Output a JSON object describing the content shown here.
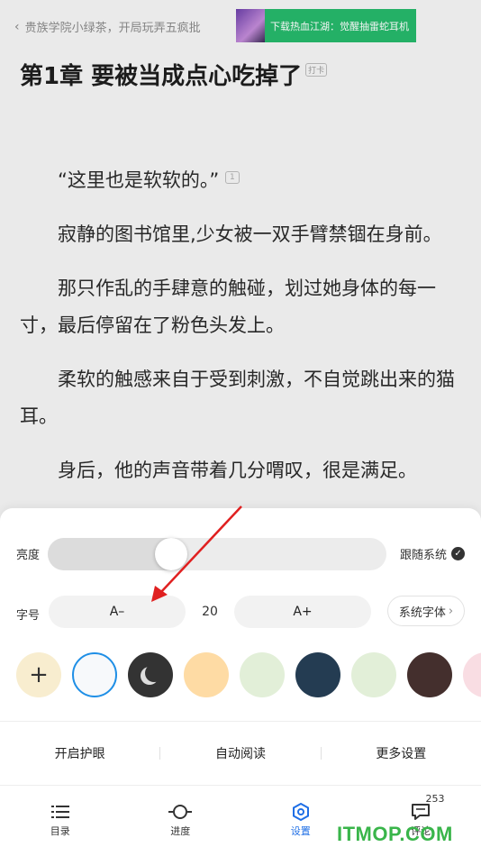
{
  "reader": {
    "back_title": "贵族学院小绿茶，开局玩弄五疯批",
    "ad_text": "下载热血江湖：觉醒抽雷蛇耳机",
    "chapter_title": "第1章 要被当成点心吃掉了",
    "checkin_label": "打卡",
    "comment_count": "1",
    "paragraphs": [
      "“这里也是软软的。”",
      "寂静的图书馆里,少女被一双手臂禁锢在身前。",
      "那只作乱的手肆意的触碰，划过她身体的每一寸，最后停留在了粉色头发上。",
      "柔软的触感来自于受到刺激，不自觉跳出来的猫耳。",
      "身后，他的声音带着几分喟叹，很是满足。"
    ]
  },
  "settings": {
    "brightness_label": "亮度",
    "brightness_level": 0.35,
    "follow_system_label": "跟随系统",
    "follow_system_checked": true,
    "font_label": "字号",
    "font_decrease_label": "A–",
    "font_size": "20",
    "font_increase_label": "A+",
    "system_font_label": "系统字体",
    "add_theme_label": "+",
    "themes": [
      {
        "name": "add",
        "color": "#f8edcf"
      },
      {
        "name": "white",
        "color": "#f7f9fb",
        "selected": true
      },
      {
        "name": "night",
        "color": "#333333"
      },
      {
        "name": "peach",
        "color": "#fedba4"
      },
      {
        "name": "mint",
        "color": "#e2efd8"
      },
      {
        "name": "navy",
        "color": "#243c52"
      },
      {
        "name": "pale-green",
        "color": "#e2efd8"
      },
      {
        "name": "brown",
        "color": "#442f2d"
      },
      {
        "name": "pink",
        "color": "#f9dde3"
      }
    ],
    "selected_ring_color": "#1f8fe6",
    "actions": {
      "eye_protect": "开启护眼",
      "auto_read": "自动阅读",
      "more_settings": "更多设置"
    }
  },
  "bottom_nav": {
    "items": [
      {
        "label": "目录",
        "icon": "list-icon"
      },
      {
        "label": "进度",
        "icon": "progress-icon"
      },
      {
        "label": "设置",
        "icon": "settings-icon",
        "active": true
      },
      {
        "label": "评论",
        "icon": "comment-icon",
        "count": "253"
      }
    ],
    "active_color": "#1f6fe6"
  },
  "watermark": "ITMOP.COM",
  "annotation": {
    "arrow_color": "#e02020"
  }
}
